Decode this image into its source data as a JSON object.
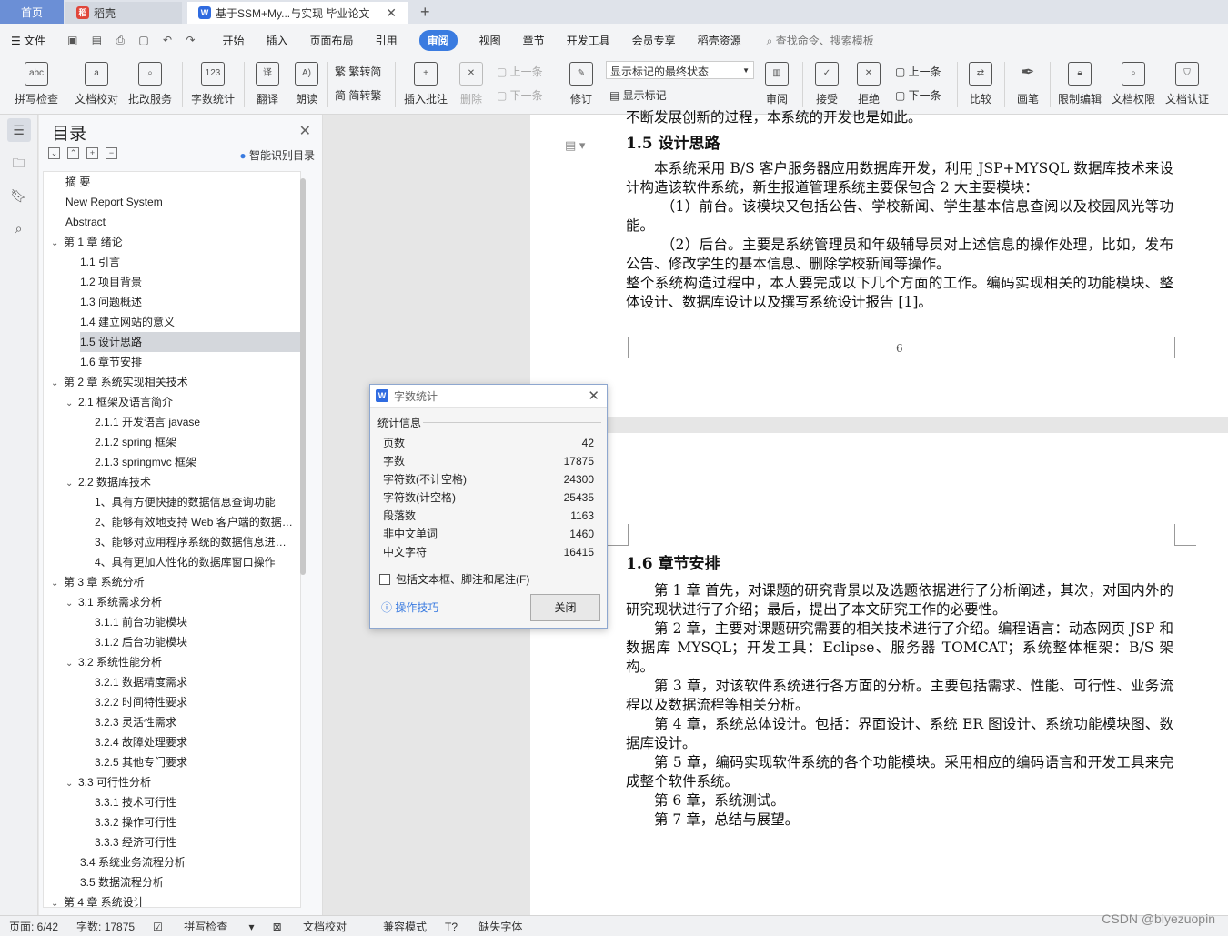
{
  "tabs": {
    "home": "首页",
    "daoke": "稻壳",
    "doc": "基于SSM+My...与实现 毕业论文"
  },
  "menu": {
    "file": "文件",
    "items": [
      "开始",
      "插入",
      "页面布局",
      "引用",
      "审阅",
      "视图",
      "章节",
      "开发工具",
      "会员专享",
      "稻壳资源"
    ],
    "active_index": 4,
    "search": "查找命令、搜索模板"
  },
  "ribbon": {
    "spell": "拼写检查",
    "proof": "文档校对",
    "batch": "批改服务",
    "wordcount": "字数统计",
    "translate": "翻译",
    "read": "朗读",
    "t2s": "繁转简",
    "s2t": "简转繁",
    "comment": "插入批注",
    "delete": "删除",
    "prev": "上一条",
    "next": "下一条",
    "revise": "修订",
    "showmode": "显示标记的最终状态",
    "showmarks": "显示标记",
    "review": "审阅",
    "accept": "接受",
    "reject": "拒绝",
    "prev2": "上一条",
    "next2": "下一条",
    "compare": "比较",
    "pen": "画笔",
    "restrict": "限制编辑",
    "perm": "文档权限",
    "cert": "文档认证"
  },
  "toc": {
    "title": "目录",
    "smart": "智能识别目录",
    "items": [
      {
        "t": "摘    要",
        "lv": 0
      },
      {
        "t": "New Report System",
        "lv": 0
      },
      {
        "t": "Abstract",
        "lv": 0
      },
      {
        "t": "第 1 章    绪论",
        "lv": 0,
        "c": 1
      },
      {
        "t": "1.1  引言",
        "lv": 1
      },
      {
        "t": "1.2  项目背景",
        "lv": 1
      },
      {
        "t": "1.3  问题概述",
        "lv": 1
      },
      {
        "t": "1.4  建立网站的意义",
        "lv": 1
      },
      {
        "t": "1.5  设计思路",
        "lv": 1,
        "sel": 1
      },
      {
        "t": "1.6  章节安排",
        "lv": 1
      },
      {
        "t": "第 2 章    系统实现相关技术",
        "lv": 0,
        "c": 1
      },
      {
        "t": "2.1 框架及语言简介",
        "lv": 1,
        "c": 1
      },
      {
        "t": "2.1.1  开发语言 javase",
        "lv": 2
      },
      {
        "t": "2.1.2 spring 框架",
        "lv": 2
      },
      {
        "t": "2.1.3    springmvc 框架",
        "lv": 2
      },
      {
        "t": "2.2  数据库技术",
        "lv": 1,
        "c": 1
      },
      {
        "t": "1、具有方便快捷的数据信息查询功能",
        "lv": 2
      },
      {
        "t": "2、能够有效地支持 Web 客户端的数据访问",
        "lv": 2
      },
      {
        "t": "3、能够对应用程序系统的数据信息进行管理",
        "lv": 2
      },
      {
        "t": "4、具有更加人性化的数据库窗口操作",
        "lv": 2
      },
      {
        "t": "第 3 章    系统分析",
        "lv": 0,
        "c": 1
      },
      {
        "t": "3.1  系统需求分析",
        "lv": 1,
        "c": 1
      },
      {
        "t": "3.1.1 前台功能模块",
        "lv": 2
      },
      {
        "t": "3.1.2 后台功能模块",
        "lv": 2
      },
      {
        "t": "3.2  系统性能分析",
        "lv": 1,
        "c": 1
      },
      {
        "t": "3.2.1 数据精度需求",
        "lv": 2
      },
      {
        "t": "3.2.2 时间特性要求",
        "lv": 2
      },
      {
        "t": "3.2.3 灵活性需求",
        "lv": 2
      },
      {
        "t": "3.2.4 故障处理要求",
        "lv": 2
      },
      {
        "t": "3.2.5 其他专门要求",
        "lv": 2
      },
      {
        "t": "3.3  可行性分析",
        "lv": 1,
        "c": 1
      },
      {
        "t": "3.3.1  技术可行性",
        "lv": 2
      },
      {
        "t": "3.3.2  操作可行性",
        "lv": 2
      },
      {
        "t": "3.3.3  经济可行性",
        "lv": 2
      },
      {
        "t": "3.4 系统业务流程分析",
        "lv": 1
      },
      {
        "t": "3.5 数据流程分析",
        "lv": 1
      },
      {
        "t": "第 4 章    系统设计",
        "lv": 0,
        "c": 1
      }
    ]
  },
  "doc": {
    "top_partial": "不断发展创新的过程，本系统的开发也是如此。",
    "h15": "1.5  设计思路",
    "p15": [
      "本系统采用 B/S 客户服务器应用数据库开发，利用 JSP+MYSQL 数据库技术来设计构造该软件系统，新生报道管理系统主要保包含 2 大主要模块：",
      "（1）前台。该模块又包括公告、学校新闻、学生基本信息查阅以及校园风光等功能。",
      "（2）后台。主要是系统管理员和年级辅导员对上述信息的操作处理，比如，发布公告、修改学生的基本信息、删除学校新闻等操作。",
      "整个系统构造过程中，本人要完成以下几个方面的工作。编码实现相关的功能模块、整体设计、数据库设计以及撰写系统设计报告 [1]。"
    ],
    "pagenum": "6",
    "h16": "1.6  章节安排",
    "p16": [
      "第 1 章 首先，对课题的研究背景以及选题依据进行了分析阐述，其次，对国内外的研究现状进行了介绍；最后，提出了本文研究工作的必要性。",
      "第 2 章，主要对课题研究需要的相关技术进行了介绍。编程语言：动态网页 JSP 和数据库 MYSQL；开发工具：Eclipse、服务器 TOMCAT；系统整体框架：B/S 架构。",
      "第 3 章，对该软件系统进行各方面的分析。主要包括需求、性能、可行性、业务流程以及数据流程等相关分析。",
      "第 4 章，系统总体设计。包括：界面设计、系统 ER 图设计、系统功能模块图、数据库设计。",
      "第 5 章，编码实现软件系统的各个功能模块。采用相应的编码语言和开发工具来完成整个软件系统。",
      "第 6 章，系统测试。",
      "第 7 章，总结与展望。"
    ]
  },
  "dialog": {
    "title": "字数统计",
    "section": "统计信息",
    "rows": [
      [
        "页数",
        "42"
      ],
      [
        "字数",
        "17875"
      ],
      [
        "字符数(不计空格)",
        "24300"
      ],
      [
        "字符数(计空格)",
        "25435"
      ],
      [
        "段落数",
        "1163"
      ],
      [
        "非中文单词",
        "1460"
      ],
      [
        "中文字符",
        "16415"
      ]
    ],
    "checkbox": "包括文本框、脚注和尾注(F)",
    "tips": "操作技巧",
    "close": "关闭"
  },
  "status": {
    "page": "页面: 6/42",
    "words": "字数: 17875",
    "spell": "拼写检查",
    "proof": "文档校对",
    "compat": "兼容模式",
    "font": "缺失字体"
  },
  "watermark": "CSDN @biyezuopin"
}
